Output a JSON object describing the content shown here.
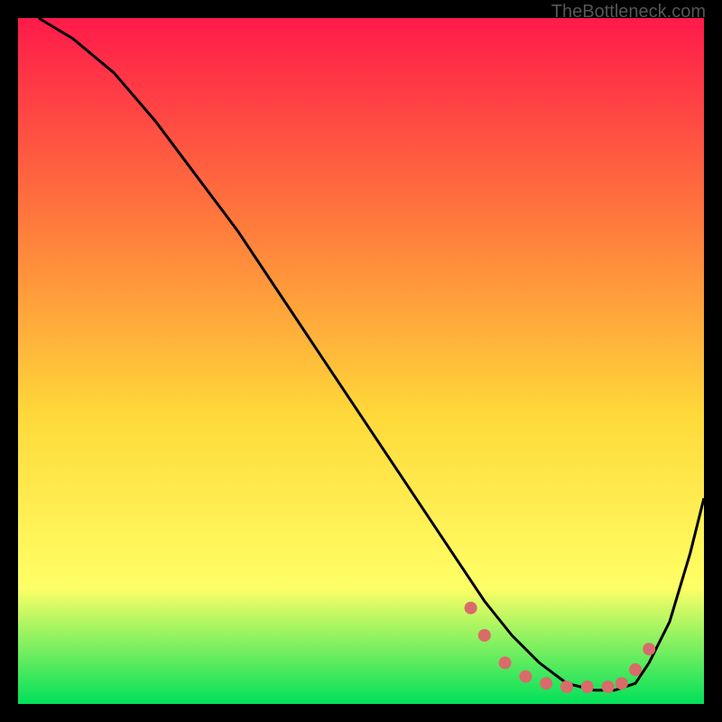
{
  "attribution": "TheBottleneck.com",
  "colors": {
    "gradient_top": "#ff1a4a",
    "gradient_mid1": "#ff7a3c",
    "gradient_mid2": "#ffd93a",
    "gradient_mid3": "#ffff66",
    "gradient_bottom": "#00e05a",
    "curve": "#000000",
    "dot": "#d96b6b",
    "frame": "#000000"
  },
  "chart_data": {
    "type": "line",
    "title": "",
    "xlabel": "",
    "ylabel": "",
    "xlim": [
      0,
      100
    ],
    "ylim": [
      0,
      100
    ],
    "curve": {
      "x": [
        3,
        8,
        14,
        20,
        26,
        32,
        38,
        44,
        50,
        56,
        60,
        64,
        68,
        72,
        76,
        80,
        84,
        87,
        90,
        92,
        95,
        98,
        100
      ],
      "y": [
        100,
        97,
        92,
        85,
        77,
        69,
        60,
        51,
        42,
        33,
        27,
        21,
        15,
        10,
        6,
        3,
        2,
        2,
        3,
        6,
        12,
        22,
        30
      ]
    },
    "dots": {
      "x": [
        66,
        68,
        71,
        74,
        77,
        80,
        83,
        86,
        88,
        90,
        92
      ],
      "y": [
        14,
        10,
        6,
        4,
        3,
        2.5,
        2.5,
        2.5,
        3,
        5,
        8
      ]
    }
  }
}
